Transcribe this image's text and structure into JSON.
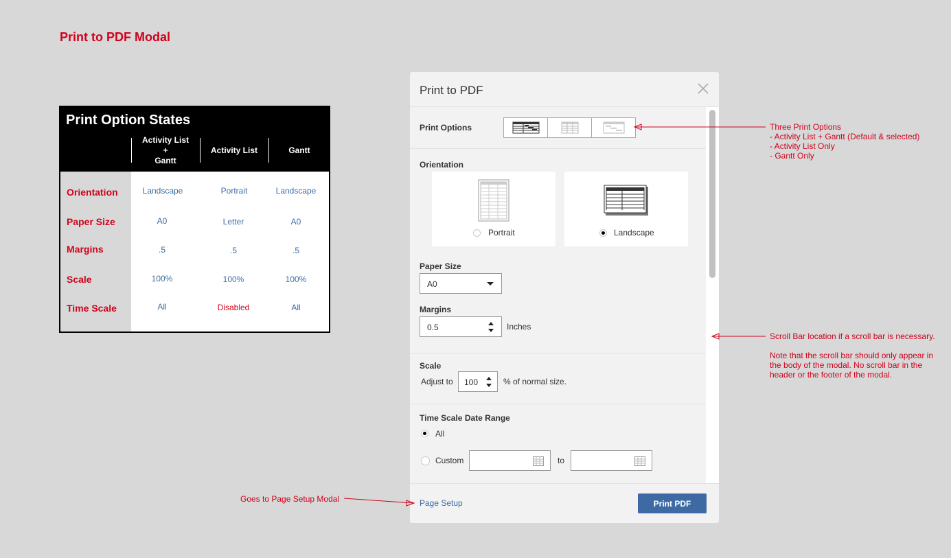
{
  "page_title": "Print to PDF Modal",
  "state_table": {
    "title": "Print Option States",
    "columns": [
      "Activity List\n+\nGantt",
      "Activity List",
      "Gantt"
    ],
    "rows": [
      {
        "label": "Orientation",
        "values": [
          "Landscape",
          "Portrait",
          "Landscape"
        ]
      },
      {
        "label": "Paper Size",
        "values": [
          "A0",
          "Letter",
          "A0"
        ]
      },
      {
        "label": "Margins",
        "values": [
          ".5",
          ".5",
          ".5"
        ]
      },
      {
        "label": "Scale",
        "values": [
          "100%",
          "100%",
          "100%"
        ]
      },
      {
        "label": "Time Scale",
        "values": [
          "All",
          "Disabled",
          "All"
        ]
      }
    ]
  },
  "modal": {
    "title": "Print to PDF",
    "print_options_label": "Print Options",
    "print_options": [
      "activity-list-gantt",
      "activity-list-only",
      "gantt-only"
    ],
    "selected_print_option": "activity-list-gantt",
    "orientation_label": "Orientation",
    "orientation": {
      "portrait_label": "Portrait",
      "landscape_label": "Landscape",
      "selected": "Landscape"
    },
    "paper_size": {
      "label": "Paper Size",
      "value": "A0"
    },
    "margins": {
      "label": "Margins",
      "value": "0.5",
      "unit": "Inches"
    },
    "scale": {
      "label": "Scale",
      "prefix": "Adjust to",
      "value": "100",
      "suffix": "% of normal size."
    },
    "time_scale": {
      "label": "Time Scale Date Range",
      "all_label": "All",
      "custom_label": "Custom",
      "to_label": "to",
      "selected": "All"
    },
    "footer": {
      "page_setup_label": "Page Setup",
      "print_button_label": "Print PDF"
    }
  },
  "annotations": {
    "print_options_note": [
      "Three Print Options",
      "- Activity List + Gantt (Default & selected)",
      "- Activity List Only",
      "- Gantt Only"
    ],
    "scroll_note_1": "Scroll Bar location if a scroll bar is necessary.",
    "scroll_note_2": "Note that the scroll bar should only appear in the body of the modal.  No scroll bar in the header or the footer of the modal.",
    "page_setup_note": "Goes to Page Setup Modal"
  },
  "colors": {
    "annotation_red": "#d0021b",
    "link_blue": "#3b6da6",
    "button_blue": "#3e6aa3"
  }
}
